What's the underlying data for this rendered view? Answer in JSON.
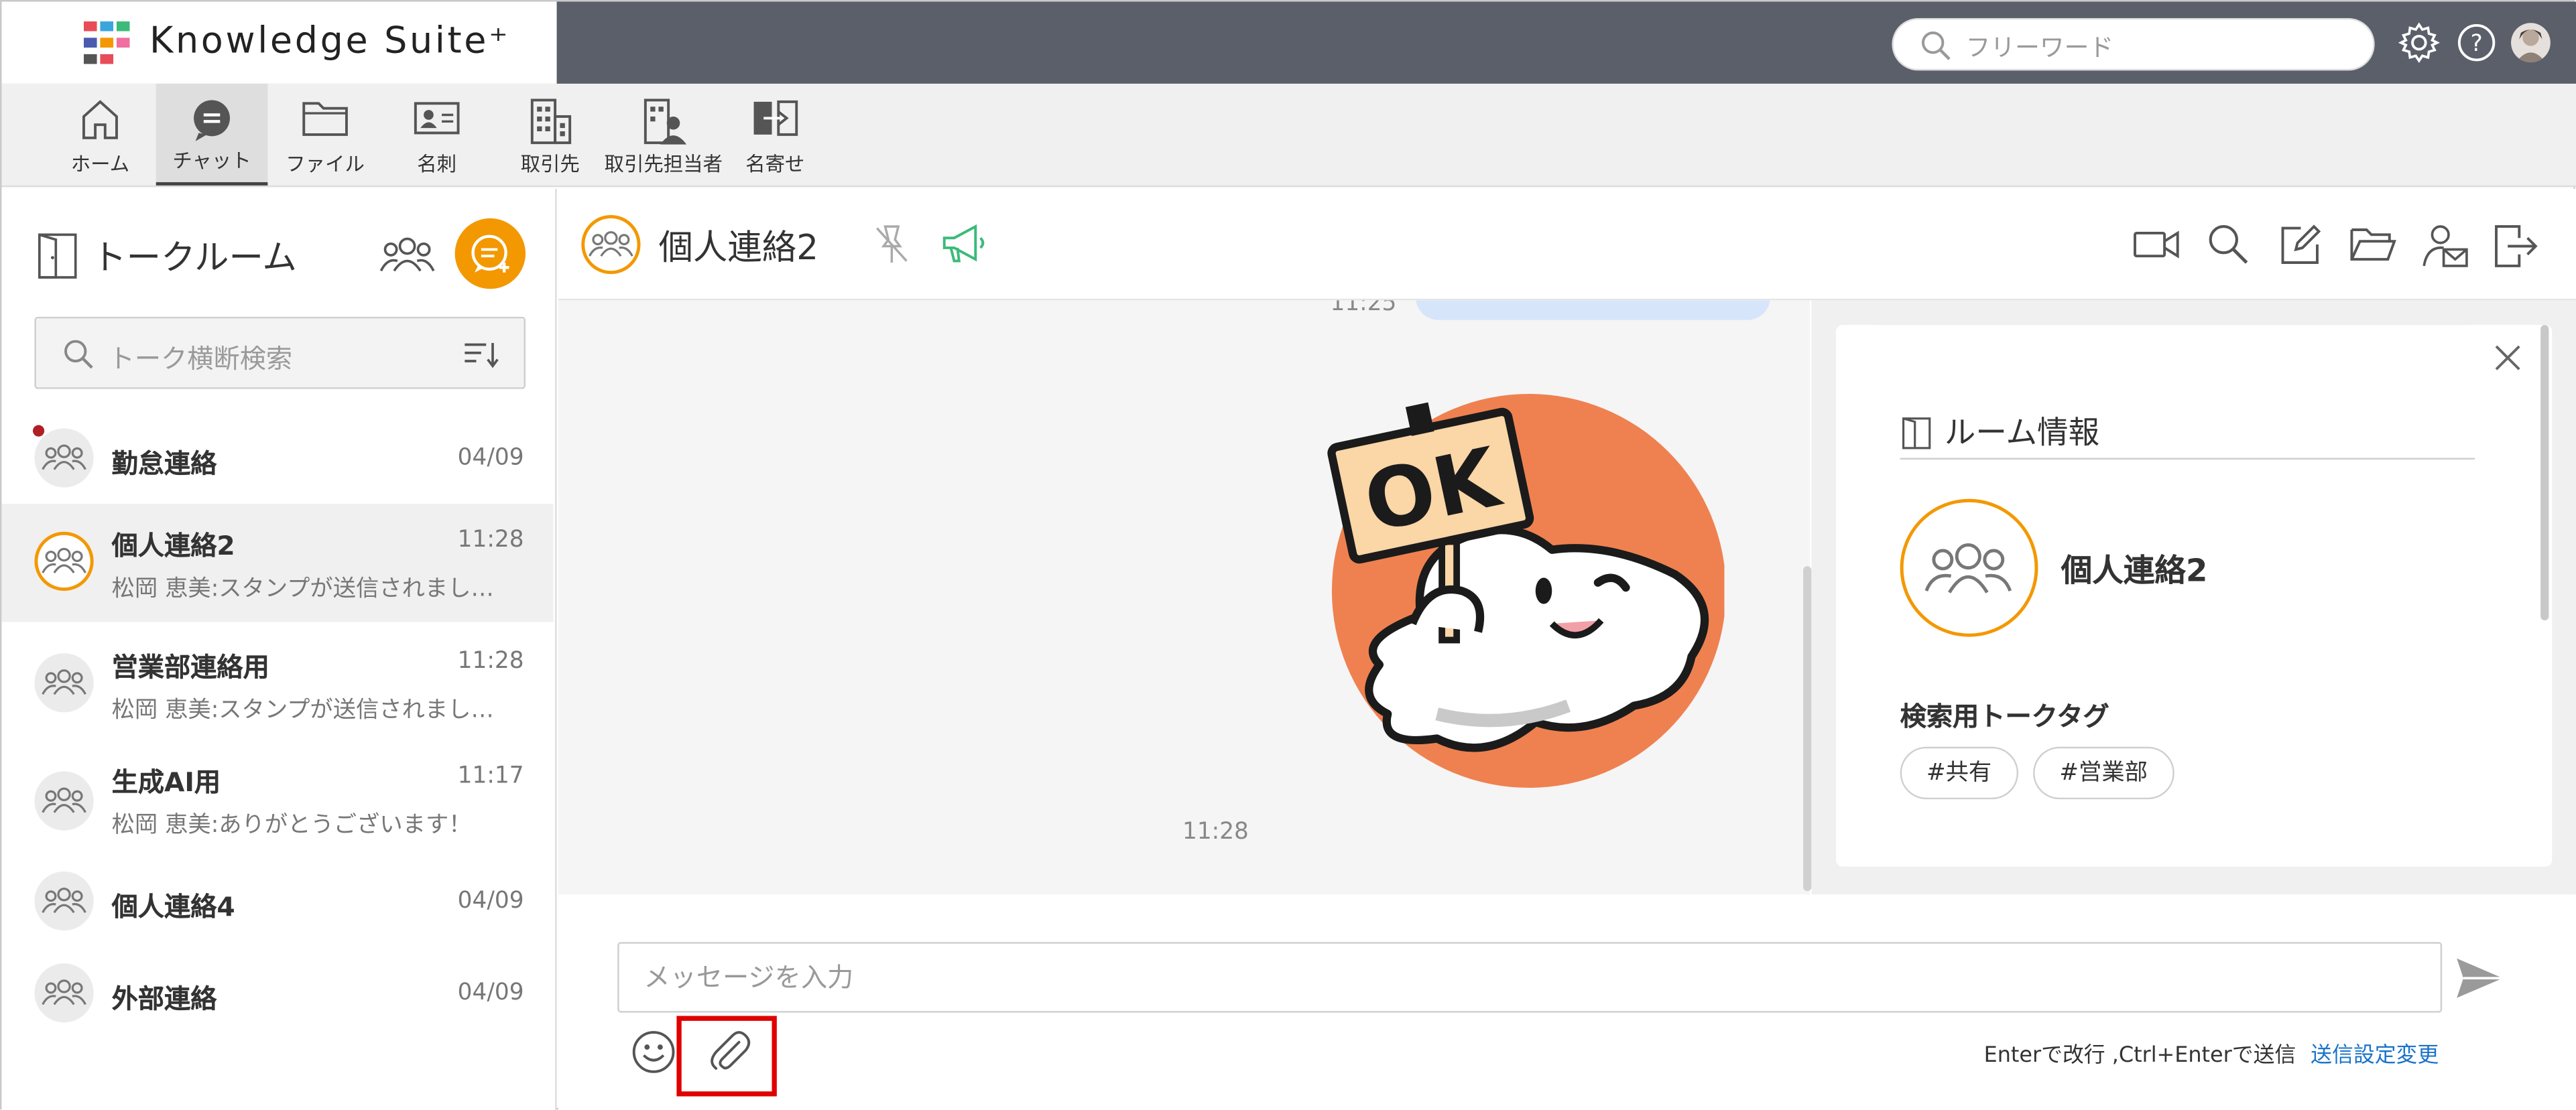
{
  "app": {
    "name": "Knowledge Suite⁺"
  },
  "topbar": {
    "search_placeholder": "フリーワード",
    "icons": [
      "search-icon",
      "gear-icon",
      "help-icon",
      "user-avatar"
    ]
  },
  "nav": {
    "items": [
      {
        "label": "ホーム",
        "icon": "home-icon"
      },
      {
        "label": "チャット",
        "icon": "chat-icon",
        "active": true
      },
      {
        "label": "ファイル",
        "icon": "folder-icon"
      },
      {
        "label": "名刺",
        "icon": "business-card-icon"
      },
      {
        "label": "取引先",
        "icon": "building-icon"
      },
      {
        "label": "取引先担当者",
        "icon": "building-person-icon"
      },
      {
        "label": "名寄せ",
        "icon": "merge-icon"
      }
    ]
  },
  "talkroom": {
    "title": "トークルーム",
    "search_placeholder": "トーク横断検索",
    "rooms": [
      {
        "name": "勤怠連絡",
        "date": "04/09",
        "preview": "",
        "unread": true
      },
      {
        "name": "個人連絡2",
        "date": "11:28",
        "preview": "松岡 恵美:スタンプが送信されまし…",
        "active": true
      },
      {
        "name": "営業部連絡用",
        "date": "11:28",
        "preview": "松岡 恵美:スタンプが送信されまし…"
      },
      {
        "name": "生成AI用",
        "date": "11:17",
        "preview": "松岡 恵美:ありがとうございます！"
      },
      {
        "name": "個人連絡4",
        "date": "04/09",
        "preview": ""
      },
      {
        "name": "外部連絡",
        "date": "04/09",
        "preview": ""
      }
    ]
  },
  "chat": {
    "title": "個人連絡2",
    "header_icons": [
      "unpin-icon",
      "megaphone-icon",
      "video-icon",
      "search-icon",
      "edit-icon",
      "folder-open-icon",
      "member-mail-icon",
      "exit-icon"
    ],
    "messages": [
      {
        "time": "11:25",
        "type": "text"
      },
      {
        "time": "11:28",
        "type": "sticker",
        "sticker_text": "OK"
      }
    ]
  },
  "room_info": {
    "title": "ルーム情報",
    "name": "個人連絡2",
    "tag_label": "検索用トークタグ",
    "tags": [
      "#共有",
      "#営業部"
    ]
  },
  "composer": {
    "placeholder": "メッセージを入力",
    "hint": "Enterで改行 ,Ctrl+Enterで送信",
    "settings_link": "送信設定変更"
  },
  "colors": {
    "accent": "#f39800",
    "topbar": "#5b5f69",
    "highlight": "#e00000",
    "link": "#1a73c9"
  }
}
